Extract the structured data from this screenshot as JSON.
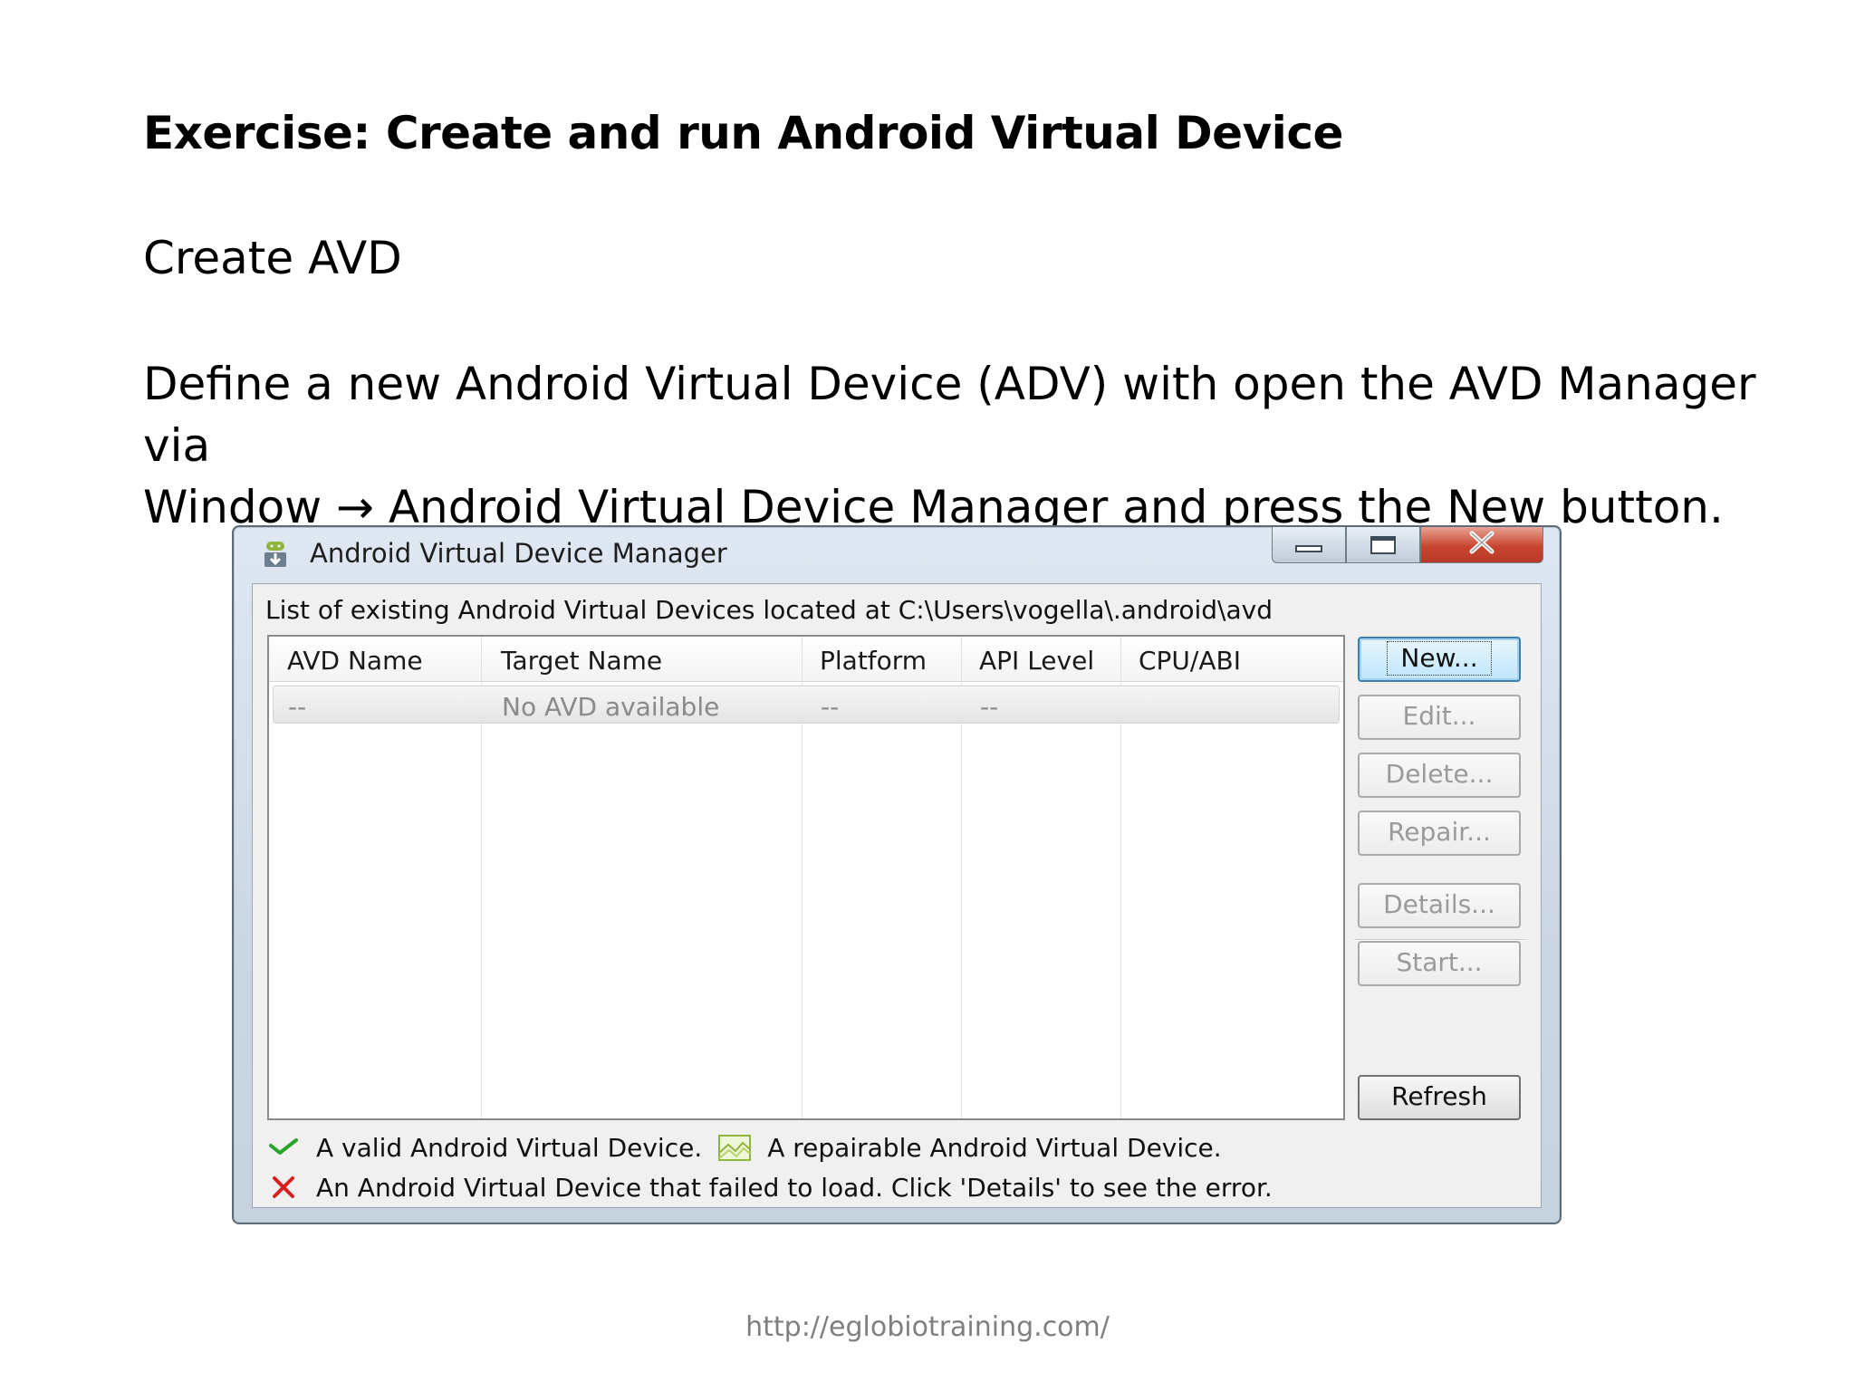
{
  "slide": {
    "title": "Exercise: Create and run Android Virtual Device",
    "subheading": "Create AVD",
    "paragraph_line1": "Define a new Android Virtual Device (ADV) with open the AVD Manager via",
    "paragraph_line2": "Window → Android Virtual Device Manager and press the New button.",
    "footer_url": "http://eglobiotraining.com/"
  },
  "window": {
    "title": "Android Virtual Device Manager",
    "icon": "android-download-icon",
    "path_label": "List of existing Android Virtual Devices located at C:\\Users\\vogella\\.android\\avd",
    "table": {
      "headers": [
        "AVD Name",
        "Target Name",
        "Platform",
        "API Level",
        "CPU/ABI"
      ],
      "row": [
        "--",
        "No AVD available",
        "--",
        "--",
        ""
      ]
    },
    "buttons": {
      "new": "New...",
      "edit": "Edit...",
      "delete": "Delete...",
      "repair": "Repair...",
      "details": "Details...",
      "start": "Start...",
      "refresh": "Refresh"
    },
    "legend": {
      "valid": "A valid Android Virtual Device.",
      "repairable": "A repairable Android Virtual Device.",
      "failed": "An Android Virtual Device that failed to load. Click 'Details' to see the error."
    },
    "colors": {
      "valid_check": "#2aa32a",
      "failed_x": "#d91e1e",
      "close_button": "#c8452f"
    }
  }
}
